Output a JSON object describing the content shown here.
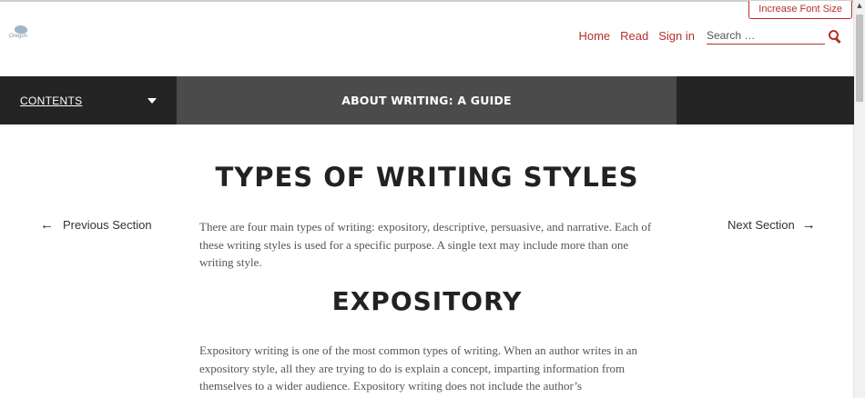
{
  "header": {
    "font_button": "Increase Font Size",
    "logo_text": "Oregon",
    "nav": [
      "Home",
      "Read",
      "Sign in"
    ],
    "search_placeholder": "Search …"
  },
  "bar": {
    "contents_label": "CONTENTS",
    "book_title": "ABOUT WRITING: A GUIDE"
  },
  "main": {
    "heading": "TYPES OF WRITING STYLES",
    "prev_label": "Previous Section",
    "next_label": "Next Section",
    "intro": "There are four main types of writing: expository, descriptive, persuasive, and narrative. Each of these writing styles is used for a specific purpose. A single text may include more than one writing style.",
    "subheading": "EXPOSITORY",
    "expository": "Expository writing is one of the most common types of writing. When an author writes in an expository style, all they are trying to do is explain a concept, imparting information from themselves to a wider audience. Expository writing does not include the author’s"
  },
  "colors": {
    "accent": "#b5302b",
    "bar": "#242424",
    "title_box": "#4b4b4b"
  }
}
